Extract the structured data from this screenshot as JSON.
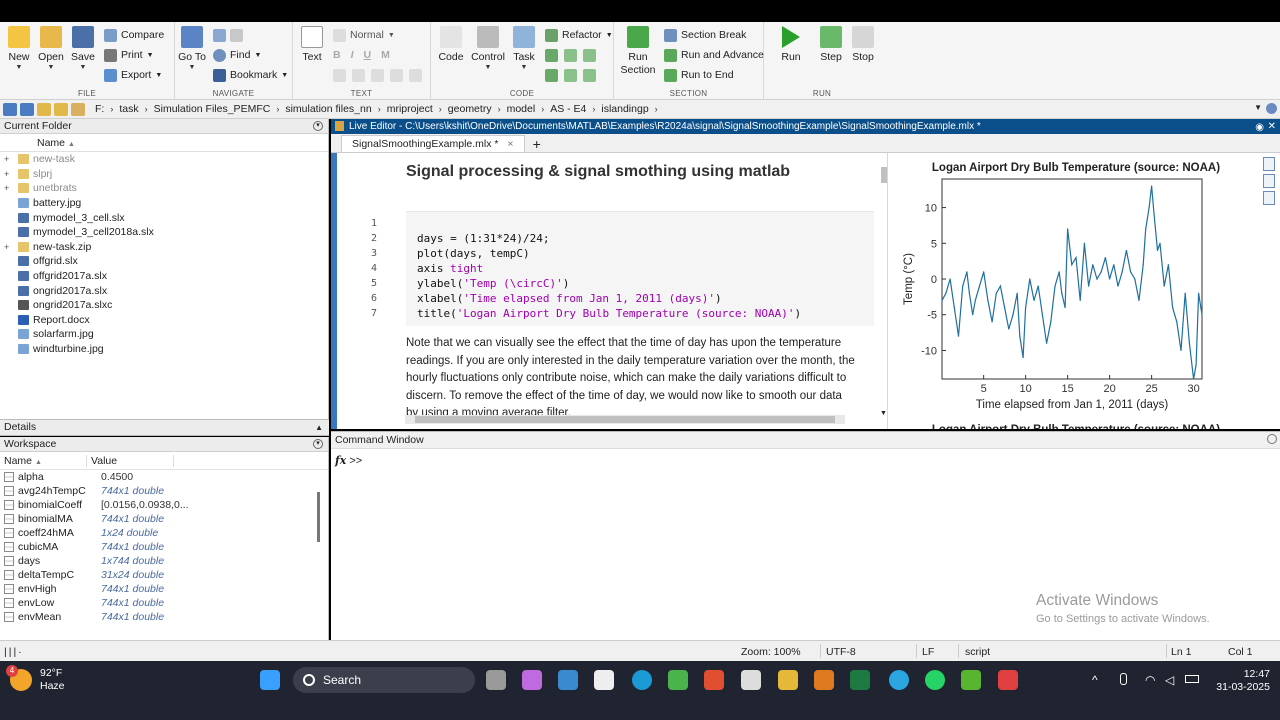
{
  "ribbon": {
    "file": {
      "label": "FILE",
      "new": "New",
      "open": "Open",
      "save": "Save",
      "compare": "Compare",
      "print": "Print",
      "export": "Export"
    },
    "navigate": {
      "label": "NAVIGATE",
      "goto": "Go To",
      "find": "Find",
      "bookmark": "Bookmark"
    },
    "text": {
      "label": "TEXT",
      "text": "Text",
      "style": "Normal",
      "bold": "B",
      "italic": "I",
      "underline": "U",
      "mono": "M"
    },
    "code": {
      "label": "CODE",
      "code": "Code",
      "control": "Control",
      "task": "Task",
      "refactor": "Refactor"
    },
    "section": {
      "label": "SECTION",
      "run_section": "Run\nSection",
      "section_break": "Section Break",
      "run_advance": "Run and Advance",
      "run_end": "Run to End"
    },
    "run": {
      "label": "RUN",
      "run": "Run",
      "step": "Step",
      "stop": "Stop"
    }
  },
  "address": {
    "crumbs": [
      "F:",
      "task",
      "Simulation Files_PEMFC",
      "simulation files_nn",
      "mriproject",
      "geometry",
      "model",
      "AS - E4",
      "islandingp"
    ]
  },
  "current_folder": {
    "title": "Current Folder",
    "col_name": "Name",
    "sort_arrow": "▲",
    "files": [
      {
        "name": "new-task",
        "kind": "folder",
        "expand": "+",
        "dim": true
      },
      {
        "name": "slprj",
        "kind": "folder",
        "expand": "+",
        "dim": true
      },
      {
        "name": "unetbrats",
        "kind": "folder",
        "expand": "+",
        "dim": true
      },
      {
        "name": "battery.jpg",
        "kind": "image",
        "expand": "",
        "dim": false
      },
      {
        "name": "mymodel_3_cell.slx",
        "kind": "slx",
        "expand": "",
        "dim": false
      },
      {
        "name": "mymodel_3_cell2018a.slx",
        "kind": "slx",
        "expand": "",
        "dim": false
      },
      {
        "name": "new-task.zip",
        "kind": "zip",
        "expand": "+",
        "dim": false
      },
      {
        "name": "offgrid.slx",
        "kind": "slx",
        "expand": "",
        "dim": false
      },
      {
        "name": "offgrid2017a.slx",
        "kind": "slx",
        "expand": "",
        "dim": false
      },
      {
        "name": "ongrid2017a.slx",
        "kind": "slx",
        "expand": "",
        "dim": false
      },
      {
        "name": "ongrid2017a.slxc",
        "kind": "slxc",
        "expand": "",
        "dim": false
      },
      {
        "name": "Report.docx",
        "kind": "doc",
        "expand": "",
        "dim": false
      },
      {
        "name": "solarfarm.jpg",
        "kind": "image",
        "expand": "",
        "dim": false
      },
      {
        "name": "windturbine.jpg",
        "kind": "image",
        "expand": "",
        "dim": false
      }
    ]
  },
  "details": {
    "title": "Details",
    "toggle": "▲"
  },
  "workspace": {
    "title": "Workspace",
    "col_name": "Name",
    "col_value": "Value",
    "vars": [
      {
        "name": "alpha",
        "value": "0.4500",
        "italic": false
      },
      {
        "name": "avg24hTempC",
        "value": "744x1 double",
        "italic": true
      },
      {
        "name": "binomialCoeff",
        "value": "[0.0156,0.0938,0...",
        "italic": false
      },
      {
        "name": "binomialMA",
        "value": "744x1 double",
        "italic": true
      },
      {
        "name": "coeff24hMA",
        "value": "1x24 double",
        "italic": true
      },
      {
        "name": "cubicMA",
        "value": "744x1 double",
        "italic": true
      },
      {
        "name": "days",
        "value": "1x744 double",
        "italic": true
      },
      {
        "name": "deltaTempC",
        "value": "31x24 double",
        "italic": true
      },
      {
        "name": "envHigh",
        "value": "744x1 double",
        "italic": true
      },
      {
        "name": "envLow",
        "value": "744x1 double",
        "italic": true
      },
      {
        "name": "envMean",
        "value": "744x1 double",
        "italic": true
      }
    ]
  },
  "editor": {
    "window_title": "Live Editor - C:\\Users\\kshit\\OneDrive\\Documents\\MATLAB\\Examples\\R2024a\\signal\\SignalSmoothingExample\\SignalSmoothingExample.mlx *",
    "tab_label": "SignalSmoothingExample.mlx *",
    "tab_close": "×",
    "tab_add": "+",
    "doc_title": "Signal processing & signal smothing using matlab",
    "code_lines": [
      {
        "n": "1",
        "plain": "",
        "str": "",
        "tail": ""
      },
      {
        "n": "2",
        "plain": "days = (1:31*24)/24;",
        "str": "",
        "tail": ""
      },
      {
        "n": "3",
        "plain": "plot(days, tempC)",
        "str": "",
        "tail": ""
      },
      {
        "n": "4",
        "plain": "axis ",
        "str": "tight",
        "tail": ""
      },
      {
        "n": "5",
        "plain": "ylabel(",
        "str": "'Temp (\\circC)'",
        "tail": ")"
      },
      {
        "n": "6",
        "plain": "xlabel(",
        "str": "'Time elapsed from Jan 1, 2011 (days)'",
        "tail": ")"
      },
      {
        "n": "7",
        "plain": "title(",
        "str": "'Logan Airport Dry Bulb Temperature (source: NOAA)'",
        "tail": ")"
      }
    ],
    "prose": "Note that we can visually see the effect that the time of day has upon the temperature readings. If you are only interested in the daily temperature variation over the month, the hourly fluctuations only contribute noise, which can make the daily variations difficult to discern. To remove the effect of the time of day, we would now like to smooth our data by using a moving average filter."
  },
  "command_window": {
    "title": "Command Window",
    "fx": "fx",
    "prompt": ">>"
  },
  "watermark": {
    "line1": "Activate Windows",
    "line2": "Go to Settings to activate Windows."
  },
  "status": {
    "zoom": "Zoom: 100%",
    "encoding": "UTF-8",
    "eol": "LF",
    "mode": "script",
    "ln": "Ln  1",
    "col": "Col  1"
  },
  "taskbar": {
    "temp": "92°F",
    "weather": "Haze",
    "badge": "4",
    "search": "Search",
    "time": "12:47",
    "date": "31-03-2025"
  },
  "chart_data": {
    "type": "line",
    "title": "Logan Airport Dry Bulb Temperature (source: NOAA)",
    "xlabel": "Time elapsed from Jan 1, 2011 (days)",
    "ylabel": "Temp (°C)",
    "xlim": [
      0.04,
      31
    ],
    "ylim": [
      -14,
      14
    ],
    "xticks": [
      5,
      10,
      15,
      20,
      25,
      30
    ],
    "yticks": [
      10,
      5,
      0,
      -5,
      -10
    ],
    "series": [
      {
        "color": "#1f6f9f",
        "x": [
          0.04,
          0.5,
          1,
          1.5,
          2,
          2.5,
          3,
          3.3,
          3.7,
          4,
          4.5,
          5,
          5.5,
          6,
          6.5,
          7,
          7.5,
          8,
          8.5,
          9,
          9.3,
          9.7,
          10,
          10.5,
          11,
          11.5,
          12,
          12.5,
          13,
          13.5,
          14,
          14.3,
          14.7,
          15,
          15.5,
          16,
          16.5,
          17,
          17.5,
          18,
          18.5,
          19,
          19.5,
          20,
          20.5,
          21,
          21.5,
          22,
          22.5,
          23,
          23.5,
          24,
          24.3,
          24.7,
          25,
          25.3,
          25.7,
          26,
          26.5,
          27,
          27.5,
          28,
          28.5,
          29,
          29.5,
          30,
          30.3,
          30.6,
          31
        ],
        "y": [
          -3,
          -2,
          0,
          -4,
          -8,
          -1,
          1,
          -2,
          -5,
          -3,
          -1,
          1,
          -3,
          -6,
          -2,
          -1,
          -4,
          -7,
          -5,
          -2,
          -8,
          -11,
          -4,
          0,
          -3,
          -1,
          -5,
          -9,
          -6,
          -1,
          1,
          -2,
          -4,
          7,
          2,
          3,
          -3,
          5,
          -1,
          2,
          0,
          1,
          3,
          0,
          2,
          -1,
          1,
          4,
          1,
          0,
          -3,
          2,
          7,
          10,
          13,
          9,
          4,
          5,
          -1,
          2,
          -4,
          -6,
          -10,
          -2,
          -9,
          -14,
          -12,
          -2,
          -5
        ]
      }
    ]
  }
}
